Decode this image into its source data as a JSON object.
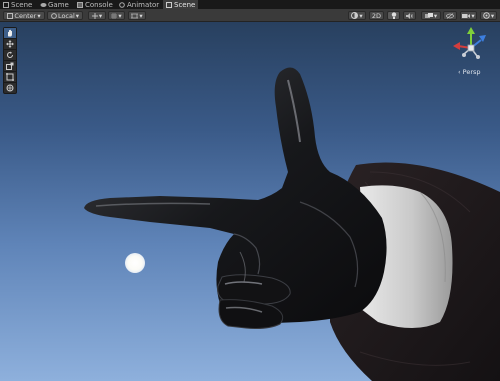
{
  "tabs": [
    {
      "label": "Scene",
      "icon": "scene-icon",
      "active": false
    },
    {
      "label": "Game",
      "icon": "game-icon",
      "active": false
    },
    {
      "label": "Console",
      "icon": "console-icon",
      "active": false
    },
    {
      "label": "Animator",
      "icon": "animator-icon",
      "active": false
    },
    {
      "label": "Scene",
      "icon": "scene-icon",
      "active": true
    }
  ],
  "toolbar": {
    "pivot_label": "Center",
    "space_label": "Local",
    "mode_2d": "2D",
    "icons": [
      "move-tool-icon",
      "grid-icon",
      "snap-icon",
      "shading-icon",
      "lighting-icon",
      "audio-icon",
      "effects-icon",
      "hidden-objects-icon",
      "camera-icon",
      "gizmos-icon"
    ]
  },
  "tools": [
    "hand-tool-icon",
    "move-tool-icon",
    "rotate-tool-icon",
    "scale-tool-icon",
    "rect-tool-icon",
    "transform-tool-icon"
  ],
  "gizmo": {
    "projection_label": "‹ Persp",
    "axes": [
      "x",
      "y",
      "z"
    ]
  },
  "colors": {
    "sky_top": "#28405f",
    "sky_bottom": "#8eb0dc",
    "x_axis": "#d33d3d",
    "y_axis": "#7fcf3a",
    "z_axis": "#3d7fe0",
    "selection": "#3e5f8a"
  }
}
